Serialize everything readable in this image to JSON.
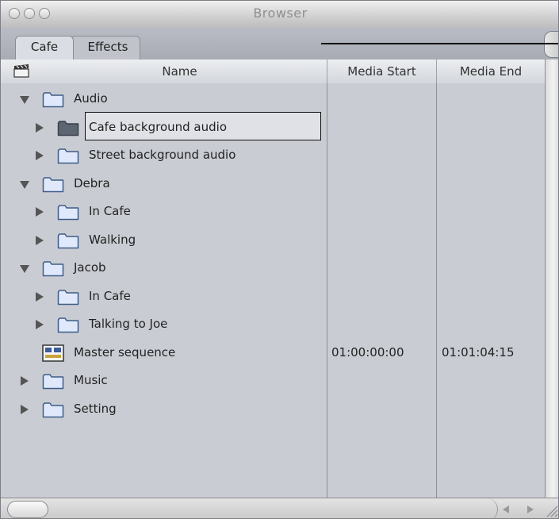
{
  "window": {
    "title": "Browser"
  },
  "tabs": [
    {
      "label": "Cafe",
      "active": true
    },
    {
      "label": "Effects",
      "active": false
    }
  ],
  "columns": {
    "name": "Name",
    "media_start": "Media Start",
    "media_end": "Media End"
  },
  "rows": [
    {
      "label": "Audio",
      "indent": 0,
      "disclosure": "expanded",
      "icon": "folder-icon",
      "media_start": "",
      "media_end": ""
    },
    {
      "label": "Cafe background audio",
      "indent": 1,
      "disclosure": "collapsed",
      "icon": "folder-icon-dark",
      "media_start": "",
      "media_end": "",
      "highlighted": true
    },
    {
      "label": "Street background audio",
      "indent": 1,
      "disclosure": "collapsed",
      "icon": "folder-icon",
      "media_start": "",
      "media_end": ""
    },
    {
      "label": "Debra",
      "indent": 0,
      "disclosure": "expanded",
      "icon": "folder-icon",
      "media_start": "",
      "media_end": ""
    },
    {
      "label": "In Cafe",
      "indent": 1,
      "disclosure": "collapsed",
      "icon": "folder-icon",
      "media_start": "",
      "media_end": ""
    },
    {
      "label": "Walking",
      "indent": 1,
      "disclosure": "collapsed",
      "icon": "folder-icon",
      "media_start": "",
      "media_end": ""
    },
    {
      "label": "Jacob",
      "indent": 0,
      "disclosure": "expanded",
      "icon": "folder-icon",
      "media_start": "",
      "media_end": ""
    },
    {
      "label": "In Cafe",
      "indent": 1,
      "disclosure": "collapsed",
      "icon": "folder-icon",
      "media_start": "",
      "media_end": ""
    },
    {
      "label": "Talking to Joe",
      "indent": 1,
      "disclosure": "collapsed",
      "icon": "folder-icon",
      "media_start": "",
      "media_end": ""
    },
    {
      "label": "Master sequence",
      "indent": 0,
      "disclosure": "none",
      "icon": "sequence-icon",
      "media_start": "01:00:00:00",
      "media_end": "01:01:04:15"
    },
    {
      "label": "Music",
      "indent": 0,
      "disclosure": "collapsed",
      "icon": "folder-icon",
      "media_start": "",
      "media_end": ""
    },
    {
      "label": "Setting",
      "indent": 0,
      "disclosure": "collapsed",
      "icon": "folder-icon",
      "media_start": "",
      "media_end": ""
    }
  ],
  "colors": {
    "folder_fill": "#dfe9fb",
    "folder_stroke": "#3f5c88",
    "folder_dark": "#5c6673",
    "panel": "#c9ccd3"
  }
}
